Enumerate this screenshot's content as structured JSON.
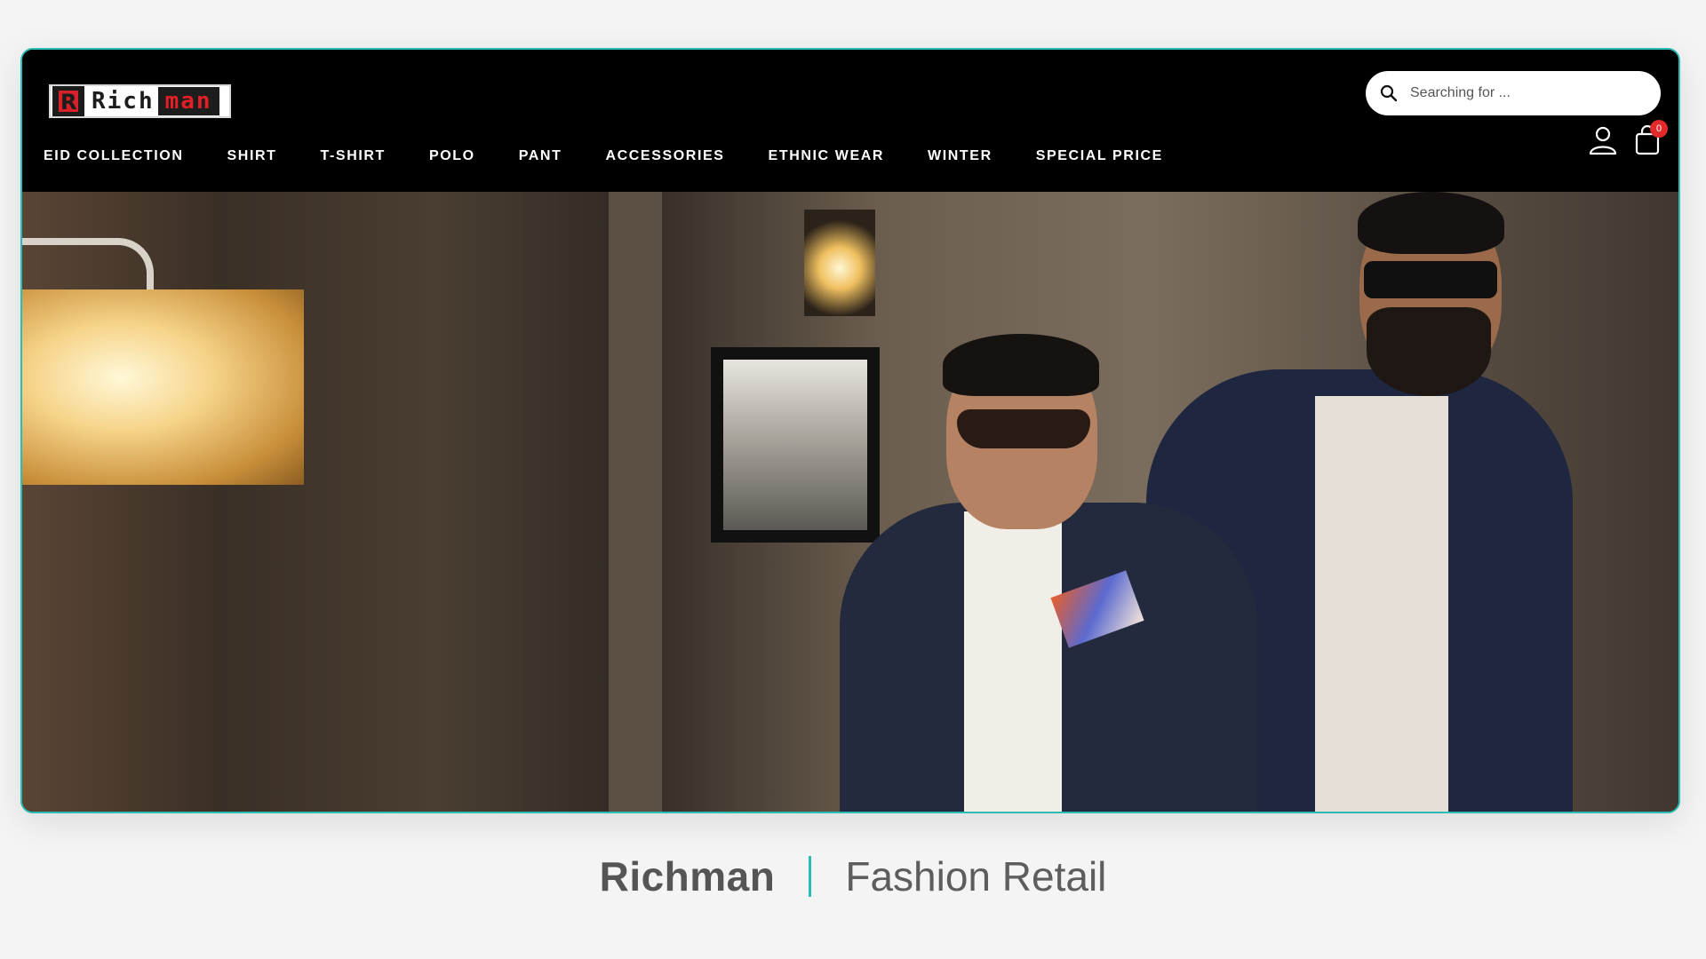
{
  "header": {
    "logo": {
      "mark": "R",
      "rich": "Rich",
      "man": "man"
    },
    "nav": [
      {
        "label": "EID COLLECTION"
      },
      {
        "label": "SHIRT"
      },
      {
        "label": "T-SHIRT"
      },
      {
        "label": "POLO"
      },
      {
        "label": "PANT"
      },
      {
        "label": "ACCESSORIES"
      },
      {
        "label": "ETHNIC WEAR"
      },
      {
        "label": "WINTER"
      },
      {
        "label": "SPECIAL PRICE"
      }
    ],
    "search": {
      "placeholder": "Searching for ...",
      "icon": "search-icon"
    },
    "icons": {
      "user": "user-icon",
      "cart": "shopping-bag-icon"
    },
    "cart_count": "0"
  },
  "hero": {
    "image": "two-men-in-blazers-and-sunglasses"
  },
  "tagline": {
    "brand": "Richman",
    "subtitle": "Fashion Retail"
  },
  "colors": {
    "accent": "#2bbcb3",
    "badge": "#e22a2a",
    "header_bg": "#000000",
    "logo_red": "#e11f26"
  }
}
